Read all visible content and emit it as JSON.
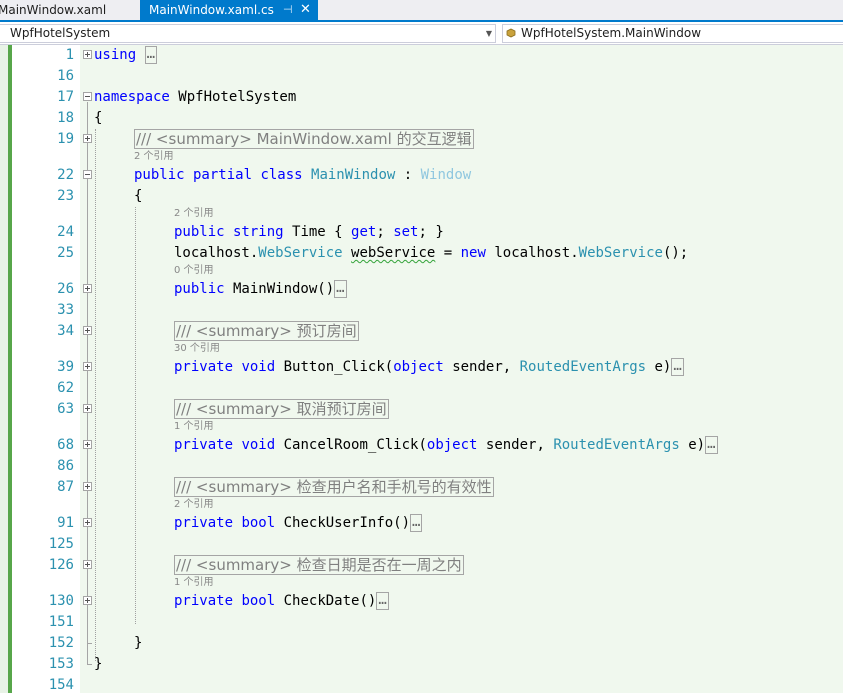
{
  "tabs": [
    {
      "label": "MainWindow.xaml",
      "active": false
    },
    {
      "label": "MainWindow.xaml.cs",
      "active": true,
      "pin": "⊣",
      "close": "✕"
    }
  ],
  "navbar": {
    "project": "WpfHotelSystem",
    "member": "WpfHotelSystem.MainWindow"
  },
  "code": {
    "line_numbers": [
      "1",
      "16",
      "17",
      "18",
      "19",
      "22",
      "23",
      "24",
      "25",
      "26",
      "33",
      "34",
      "39",
      "62",
      "63",
      "68",
      "86",
      "87",
      "91",
      "125",
      "126",
      "130",
      "151",
      "152",
      "153",
      "154"
    ],
    "l1_using": "using",
    "collapsed": "…",
    "namespace_kw": "namespace",
    "namespace_name": " WpfHotelSystem",
    "open_brace": "{",
    "close_brace": "}",
    "summary_main": "/// <summary> MainWindow.xaml 的交互逻辑",
    "lens_class": "2 个引用",
    "class_public": "public",
    "class_partial": " partial",
    "class_kw": " class",
    "class_name": " MainWindow",
    "class_colon": " : ",
    "class_base": "Window",
    "lens_time": "2 个引用",
    "time_public": "public",
    "time_string": " string",
    "time_rest1": " Time { ",
    "time_get": "get",
    "time_mid": "; ",
    "time_set": "set",
    "time_rest2": "; }",
    "ws_localhost1": "localhost.",
    "ws_type1": "WebService",
    "ws_space": " ",
    "ws_var": "webService",
    "ws_eq": " = ",
    "ws_new": "new",
    "ws_localhost2": " localhost.",
    "ws_type2": "WebService",
    "ws_end": "();",
    "lens_ctor": "0 个引用",
    "ctor_public": "public",
    "ctor_name": " MainWindow()",
    "summary_book": "/// <summary> 预订房间",
    "lens_button": "30 个引用",
    "btn_private": "private",
    "btn_void": " void",
    "btn_name": " Button_Click(",
    "btn_object": "object",
    "btn_sender": " sender, ",
    "btn_args": "RoutedEventArgs",
    "btn_e": " e)",
    "summary_cancel": "/// <summary> 取消预订房间",
    "lens_cancel": "1 个引用",
    "cancel_private": "private",
    "cancel_void": " void",
    "cancel_name": " CancelRoom_Click(",
    "cancel_object": "object",
    "cancel_sender": " sender, ",
    "cancel_args": "RoutedEventArgs",
    "cancel_e": " e)",
    "summary_check": "/// <summary> 检查用户名和手机号的有效性",
    "lens_check": "2 个引用",
    "check_private": "private",
    "check_bool": " bool",
    "check_name": " CheckUserInfo()",
    "summary_date": "/// <summary> 检查日期是否在一周之内",
    "lens_date": "1 个引用",
    "date_private": "private",
    "date_bool": " bool",
    "date_name": " CheckDate()"
  },
  "colors": {
    "keyword": "#0000ff",
    "type": "#2b91af",
    "line_number": "#2b91af",
    "comment": "#808080",
    "accent": "#007acc",
    "change_bar": "#57a64a"
  }
}
